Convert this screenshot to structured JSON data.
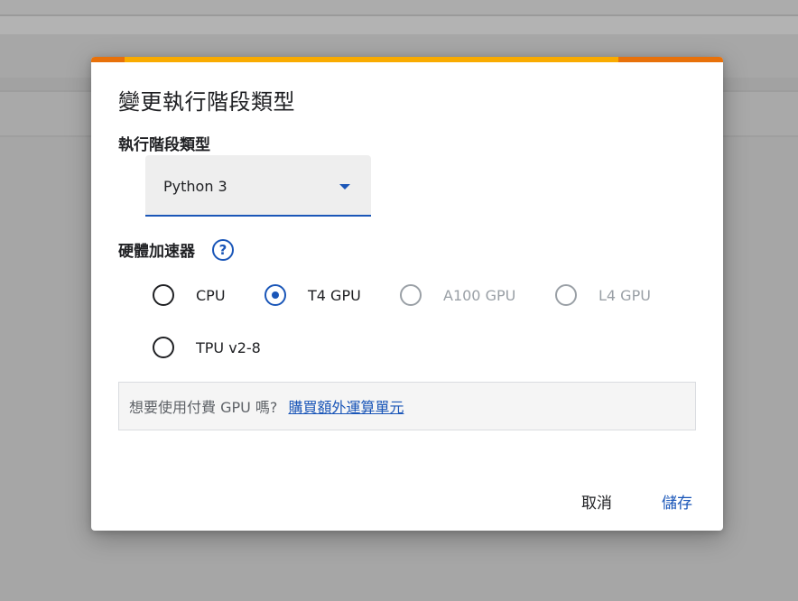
{
  "dialog": {
    "title": "變更執行階段類型",
    "runtime_label": "執行階段類型",
    "runtime_value": "Python 3",
    "accelerator_label": "硬體加速器",
    "help_symbol": "?",
    "options": [
      {
        "label": "CPU",
        "checked": false,
        "disabled": false
      },
      {
        "label": "T4 GPU",
        "checked": true,
        "disabled": false
      },
      {
        "label": "A100 GPU",
        "checked": false,
        "disabled": true
      },
      {
        "label": "L4 GPU",
        "checked": false,
        "disabled": true
      },
      {
        "label": "TPU v2-8",
        "checked": false,
        "disabled": false
      }
    ],
    "promo_text": "想要使用付費 GPU 嗎?",
    "promo_link": "購買額外運算單元",
    "cancel_label": "取消",
    "save_label": "儲存"
  },
  "colors": {
    "accent": "#1a56b8",
    "progress_track": "#e8710a",
    "progress_fill": "#f9ab00",
    "overlay": "#a9a9a9"
  },
  "icons": {
    "dropdown": "chevron-down-icon",
    "help": "help-circle-icon"
  }
}
